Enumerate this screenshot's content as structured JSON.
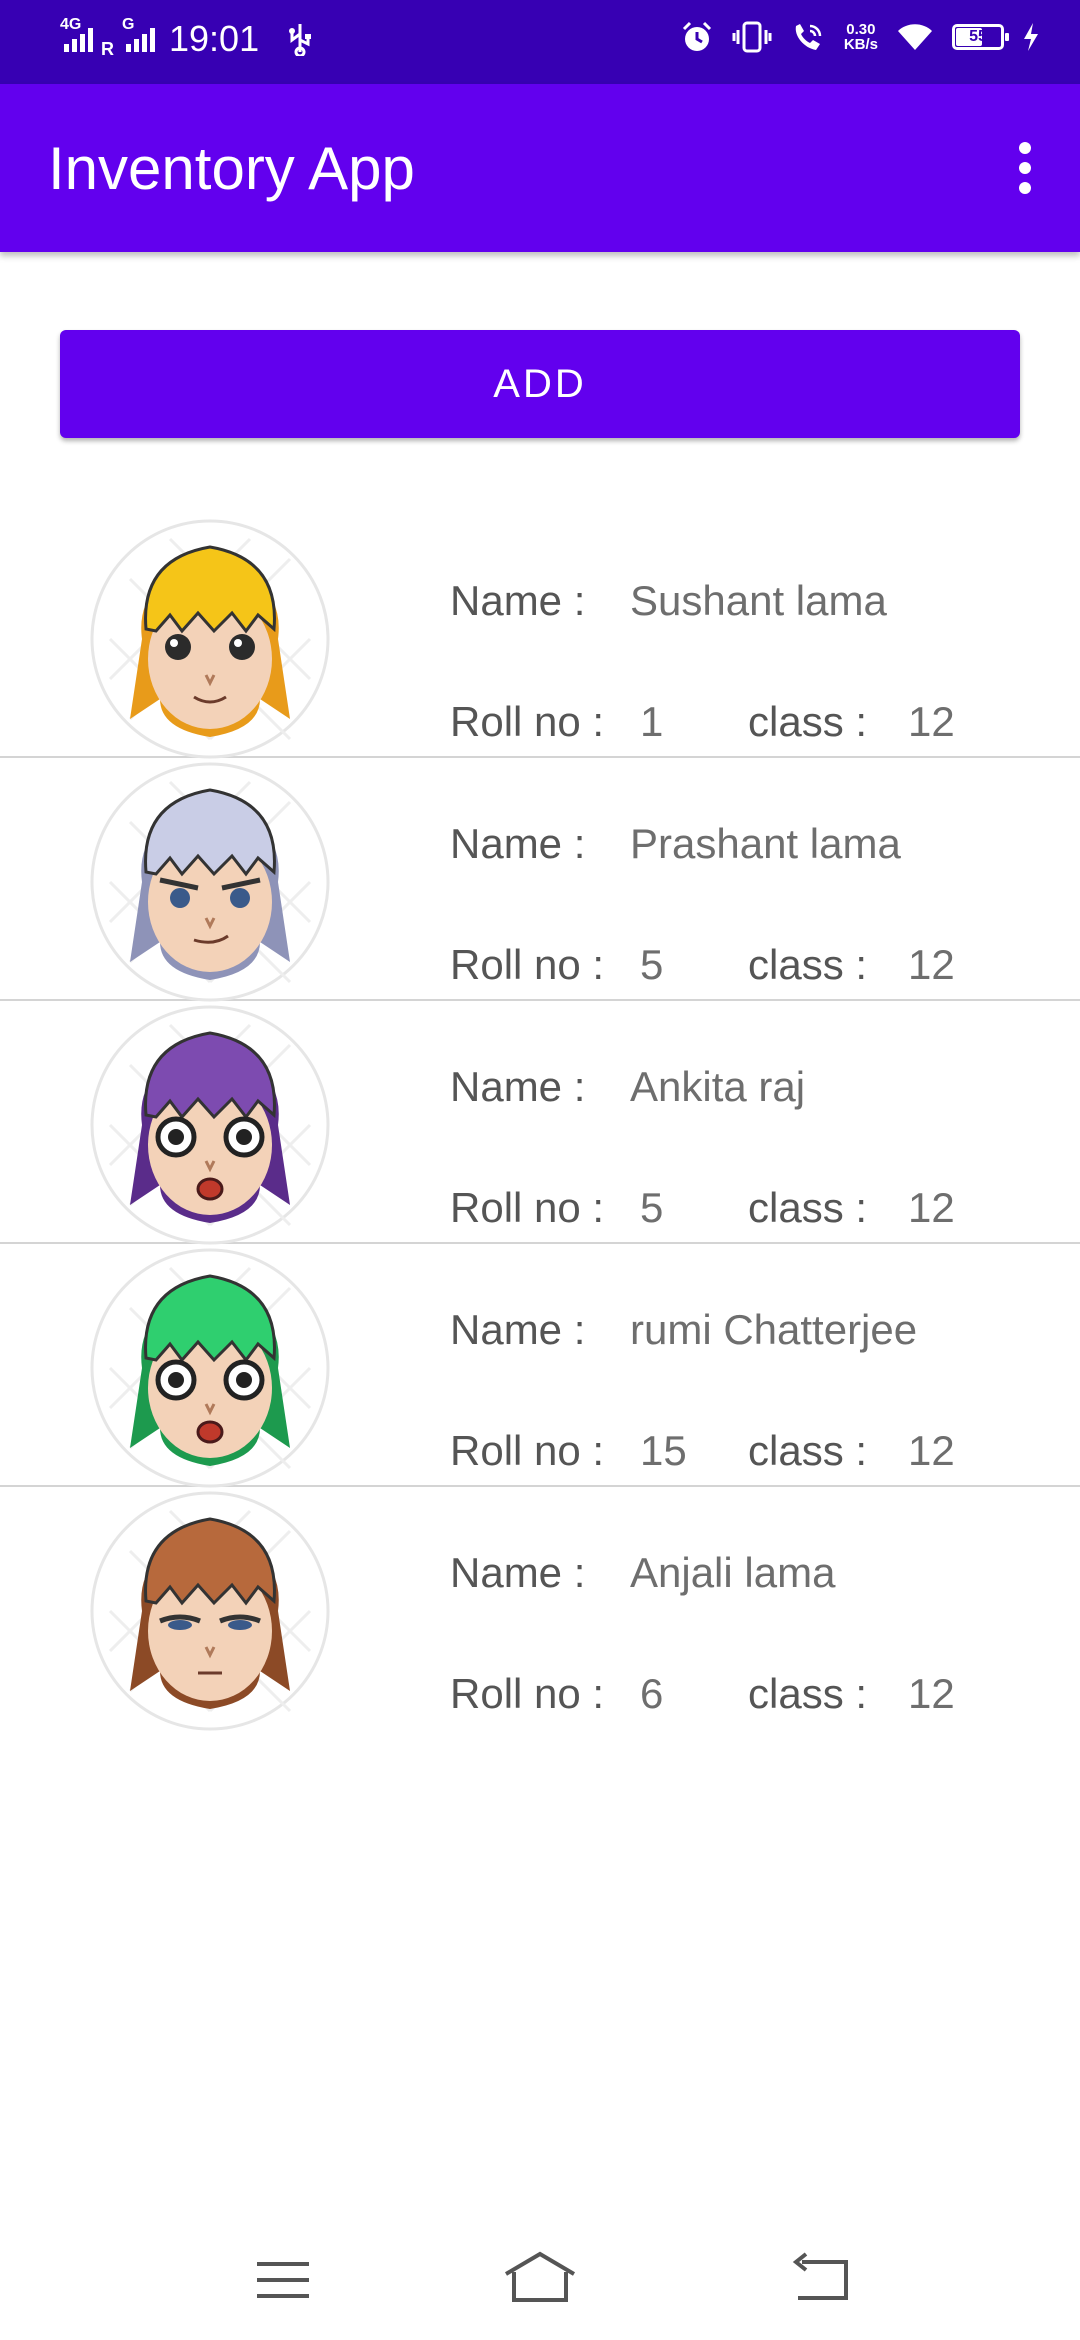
{
  "status_bar": {
    "time": "19:01",
    "network_1": "4G",
    "network_2_prefix": "R",
    "network_2": "G",
    "speed_value": "0.30",
    "speed_unit": "KB/s",
    "battery": "55",
    "icons": [
      "usb-icon",
      "alarm-icon",
      "vibrate-icon",
      "wifi-call-icon",
      "wifi-icon",
      "battery-icon",
      "charging-icon"
    ]
  },
  "app_bar": {
    "title": "Inventory App",
    "menu_icon": "more-vert-icon"
  },
  "add_button": {
    "label": "ADD"
  },
  "labels": {
    "name": "Name :",
    "roll": "Roll no :",
    "class": "class :"
  },
  "students": [
    {
      "name": "Sushant lama",
      "roll": "1",
      "class": "12",
      "hair_color": "#f5c518",
      "hair_shade": "#e89b1a",
      "skin": "#f3d2b8",
      "face": "calm"
    },
    {
      "name": "Prashant lama",
      "roll": "5",
      "class": "12",
      "hair_color": "#c9cde6",
      "hair_shade": "#8e93b8",
      "skin": "#f3d2b8",
      "face": "smirk"
    },
    {
      "name": "Ankita raj",
      "roll": "5",
      "class": "12",
      "hair_color": "#7d4bb0",
      "hair_shade": "#5a2c8a",
      "skin": "#f3d2b8",
      "face": "shock"
    },
    {
      "name": "rumi Chatterjee",
      "roll": "15",
      "class": "12",
      "hair_color": "#2fcf6f",
      "hair_shade": "#1d9a4e",
      "skin": "#f3d2b8",
      "face": "shock"
    },
    {
      "name": "Anjali lama",
      "roll": "6",
      "class": "12",
      "hair_color": "#b7693c",
      "hair_shade": "#8c4a26",
      "skin": "#f3d2b8",
      "face": "sleepy"
    }
  ],
  "nav_bar": {
    "icons": [
      "menu-icon",
      "home-icon",
      "back-icon"
    ]
  },
  "colors": {
    "status_bar": "#3700b3",
    "primary": "#6200ee",
    "divider": "#d4d4d4",
    "text": "#5a5a5a"
  }
}
